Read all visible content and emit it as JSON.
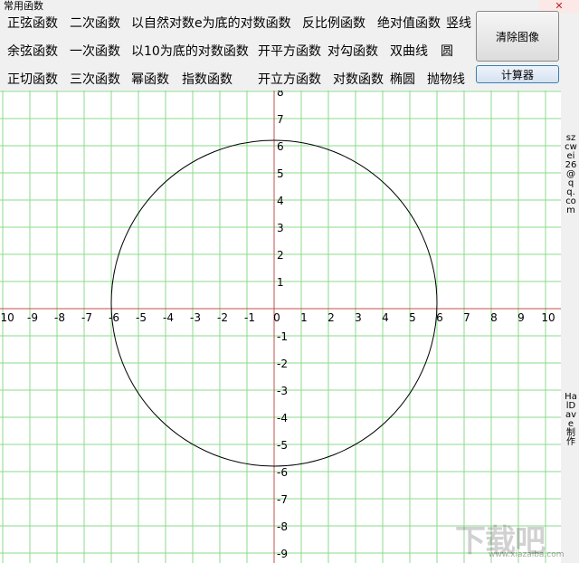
{
  "window": {
    "title": "常用函数",
    "close_label": "✕"
  },
  "function_buttons": {
    "row1": [
      "正弦函数",
      "二次函数",
      "以自然对数e为底的对数函数",
      "反比例函数",
      "绝对值函数",
      "竖线"
    ],
    "row2": [
      "余弦函数",
      "一次函数",
      "以10为底的对数函数",
      "开平方函数",
      "对勾函数",
      "双曲线",
      "圆"
    ],
    "row3": [
      "正切函数",
      "三次函数",
      "幂函数",
      "指数函数",
      "开立方函数",
      "对数函数",
      "椭圆",
      "抛物线"
    ]
  },
  "actions": {
    "clear_label": "清除图像",
    "calculator_label": "计算器"
  },
  "side_labels": {
    "email": "szcwei26@qq.com",
    "author": "HalDave制作"
  },
  "watermark": {
    "text": "下载吧",
    "url": "www.xiazaiba.com"
  },
  "colors": {
    "grid": "#8ed88e",
    "axis": "#c0504d",
    "curve": "#000000"
  },
  "chart_data": {
    "type": "line",
    "title": "",
    "xlabel": "",
    "ylabel": "",
    "xlim": [
      -10,
      10
    ],
    "ylim": [
      -9,
      8
    ],
    "x_ticks": [
      -10,
      -9,
      -8,
      -7,
      -6,
      -5,
      -4,
      -3,
      -2,
      -1,
      0,
      1,
      2,
      3,
      4,
      5,
      6,
      7,
      8,
      9,
      10
    ],
    "y_ticks": [
      8,
      7,
      6,
      5,
      4,
      3,
      2,
      1,
      -1,
      -2,
      -3,
      -4,
      -5,
      -6,
      -7,
      -8,
      -9
    ],
    "grid": true,
    "series": [
      {
        "shape": "circle",
        "center": [
          0,
          0.2
        ],
        "radius": 6
      }
    ]
  }
}
